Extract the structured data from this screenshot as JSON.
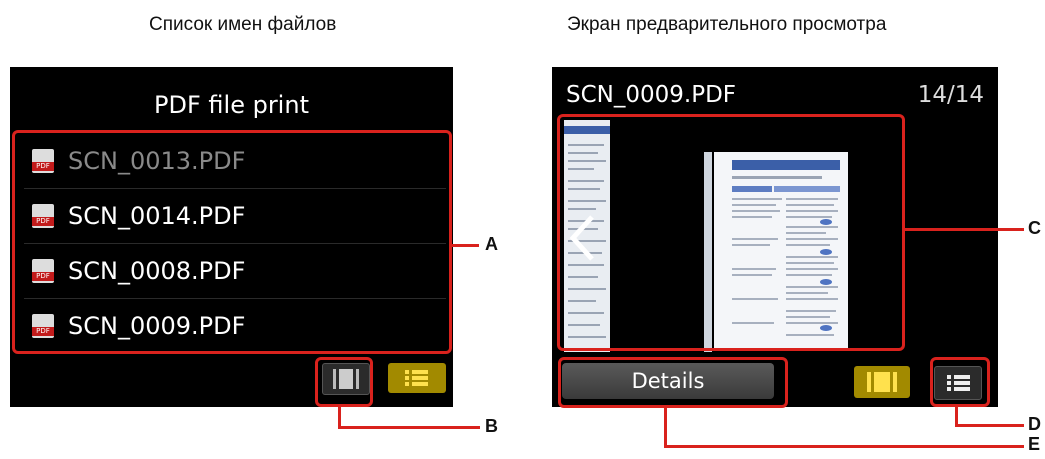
{
  "captions": {
    "left": "Список имен файлов",
    "right": "Экран предварительного просмотра"
  },
  "file_list_screen": {
    "title": "PDF file print",
    "files": [
      {
        "name": "SCN_0013.PDF",
        "dimmed": true
      },
      {
        "name": "SCN_0014.PDF",
        "dimmed": false
      },
      {
        "name": "SCN_0008.PDF",
        "dimmed": false
      },
      {
        "name": "SCN_0009.PDF",
        "dimmed": false
      }
    ],
    "buttons": {
      "preview_view": "preview-view-icon",
      "list_view": "list-view-icon"
    }
  },
  "preview_screen": {
    "file_name": "SCN_0009.PDF",
    "page_counter": "14/14",
    "details_label": "Details",
    "buttons": {
      "previous": "chevron-left-icon",
      "preview_view": "preview-view-icon",
      "list_view": "list-view-icon"
    }
  },
  "callouts": {
    "a": "A",
    "b": "B",
    "c": "C",
    "d": "D",
    "e": "E"
  },
  "colors": {
    "highlight": "#d9221d",
    "selected_button": "#a28a00",
    "screen_bg": "#000000"
  }
}
